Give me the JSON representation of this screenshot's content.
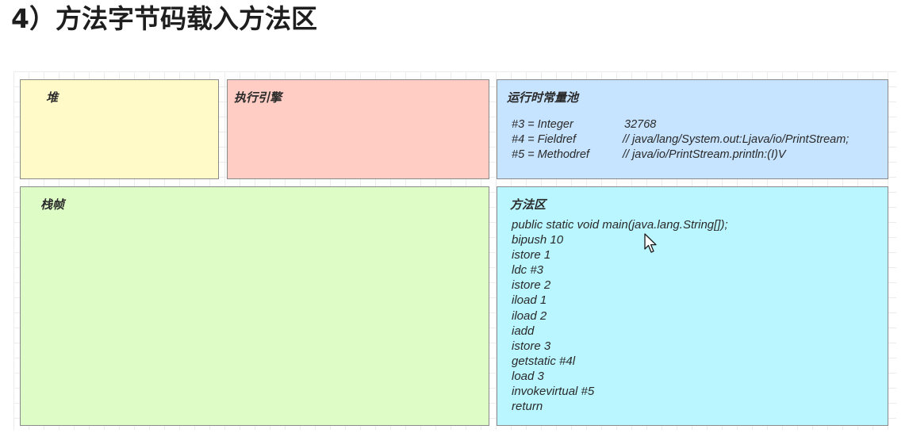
{
  "heading": "4）方法字节码载入方法区",
  "boxes": {
    "heap": {
      "title": "堆"
    },
    "engine": {
      "title": "执行引擎"
    },
    "pool": {
      "title": "运行时常量池",
      "rows": [
        {
          "ref": "#3 = Integer",
          "value": "32768"
        },
        {
          "ref": "#4 = Fieldref",
          "value": "// java/lang/System.out:Ljava/io/PrintStream;"
        },
        {
          "ref": "#5 = Methodref",
          "value": "// java/io/PrintStream.println:(I)V"
        }
      ]
    },
    "stack": {
      "title": "栈帧"
    },
    "method": {
      "title": "方法区",
      "lines": [
        "public static void main(java.lang.String[]);",
        "bipush 10",
        "istore 1",
        "ldc #3",
        "istore 2",
        "iload 1",
        "iload 2",
        "iadd",
        "istore 3",
        "getstatic #4l",
        "load 3",
        "invokevirtual #5",
        "return"
      ]
    }
  },
  "colors": {
    "heap": "#fffac8",
    "engine": "#ffcdc4",
    "pool": "#c6e3ff",
    "stack": "#defcc6",
    "method": "#baf6ff"
  },
  "cursor_icon": "mouse-pointer-icon"
}
